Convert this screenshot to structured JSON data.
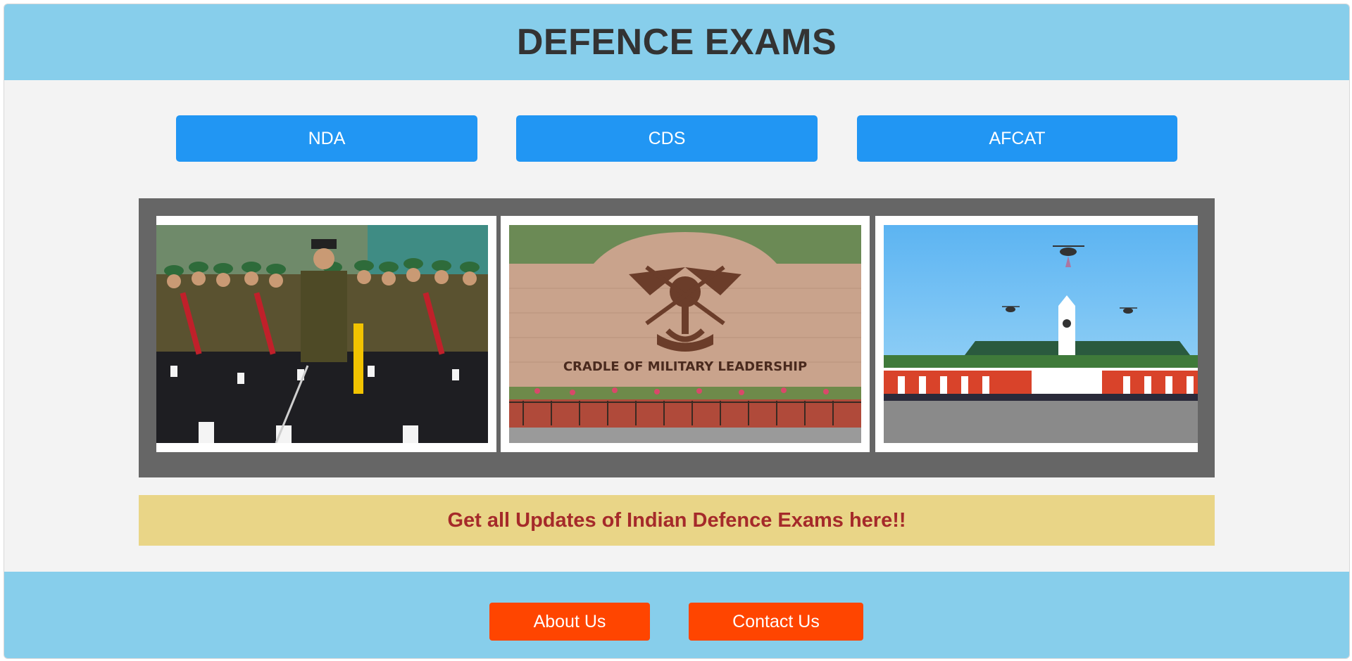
{
  "header": {
    "title": "DEFENCE EXAMS"
  },
  "exam_nav": {
    "items": [
      {
        "label": "NDA"
      },
      {
        "label": "CDS"
      },
      {
        "label": "AFCAT"
      }
    ]
  },
  "gallery": {
    "images": [
      {
        "name": "marching-cadets-photo"
      },
      {
        "name": "cradle-of-military-leadership-photo",
        "caption": "CRADLE OF MILITARY LEADERSHIP"
      },
      {
        "name": "academy-building-helicopters-photo"
      }
    ]
  },
  "banner": {
    "text": "Get all Updates of Indian Defence Exams here!!"
  },
  "footer": {
    "about_label": "About Us",
    "contact_label": "Contact Us"
  },
  "colors": {
    "header_bg": "#87ceeb",
    "button_blue": "#2196f3",
    "banner_bg": "#e9d587",
    "banner_text": "#a52a2a",
    "footer_button": "#ff4500"
  }
}
